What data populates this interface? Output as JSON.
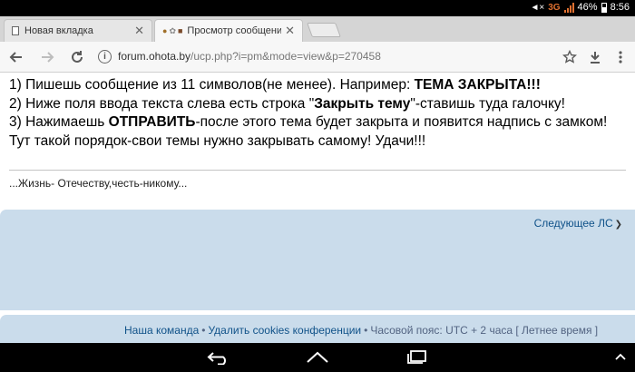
{
  "status_bar": {
    "network": "3G",
    "battery": "46%",
    "time": "8:56"
  },
  "tabs": [
    {
      "title": "Новая вкладка",
      "active": false
    },
    {
      "title": "Просмотр сообщения",
      "active": true
    }
  ],
  "toolbar": {
    "url_domain": "forum.ohota.by",
    "url_path": "/ucp.php?i=pm&mode=view&p=270458"
  },
  "message": {
    "line1_text": "1) Пишешь сообщение из 11 символов(не менее). Например: ",
    "line1_bold": "ТЕМА ЗАКРЫТА!!!",
    "line2_start": "2) Ниже поля ввода текста слева есть строка \"",
    "line2_bold": "Закрыть тему",
    "line2_end": "\"-ставишь туда галочку!",
    "line3_start": "3) Нажимаешь ",
    "line3_bold": "ОТПРАВИТЬ",
    "line3_end": "-после этого тема будет закрыта и появится надпись с замком!",
    "line4": "Тут такой порядок-свои темы нужно закрывать самому! Удачи!!!"
  },
  "signature": "...Жизнь- Отечеству,честь-никому...",
  "next_message_link": "Следующее ЛС",
  "footer": {
    "team": "Наша команда",
    "delete_cookies": "Удалить cookies конференции",
    "timezone": "Часовой пояс: UTC + 2 часа [ Летнее время ]"
  },
  "colors": {
    "link": "#105289",
    "panel_bg": "#cadceb",
    "status_orange": "#e07030"
  }
}
